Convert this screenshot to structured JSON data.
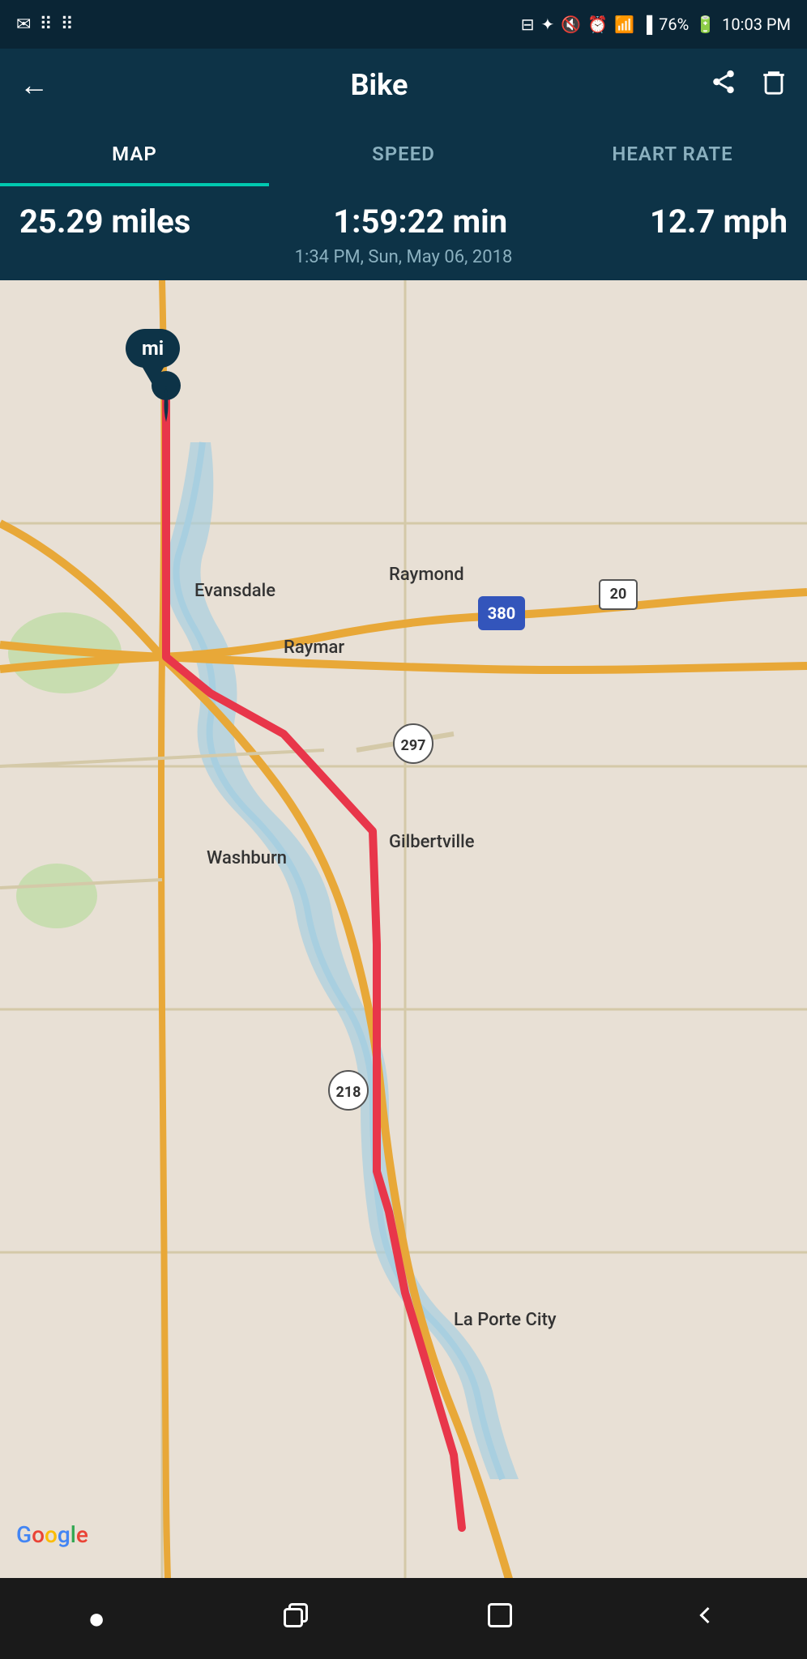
{
  "statusBar": {
    "leftIcons": [
      "gmail-icon",
      "grid-icon",
      "dots-icon"
    ],
    "battery": "76%",
    "time": "10:03 PM",
    "rightIcons": [
      "sd-icon",
      "bluetooth-icon",
      "mute-icon",
      "alarm-icon",
      "wifi-icon",
      "signal-icon",
      "battery-icon"
    ]
  },
  "header": {
    "backLabel": "←",
    "title": "Bike",
    "shareLabel": "⎋",
    "deleteLabel": "🗑"
  },
  "tabs": [
    {
      "id": "map",
      "label": "MAP",
      "active": true
    },
    {
      "id": "speed",
      "label": "SPEED",
      "active": false
    },
    {
      "id": "heartrate",
      "label": "HEART RATE",
      "active": false
    }
  ],
  "stats": {
    "distance": "25.29 miles",
    "duration": "1:59:22 min",
    "speed": "12.7 mph",
    "datetime": "1:34 PM, Sun, May 06, 2018"
  },
  "map": {
    "markerLabel": "mi",
    "googleLogoText": "Google",
    "places": [
      "Evansdale",
      "Raymond",
      "Raymar",
      "Washburn",
      "Gilbertville",
      "La Porte City"
    ],
    "highways": [
      "380",
      "297",
      "218"
    ]
  },
  "navBar": {
    "circleBtn": "●",
    "recentBtn": "⊟",
    "homeBtn": "□",
    "backBtn": "←"
  }
}
